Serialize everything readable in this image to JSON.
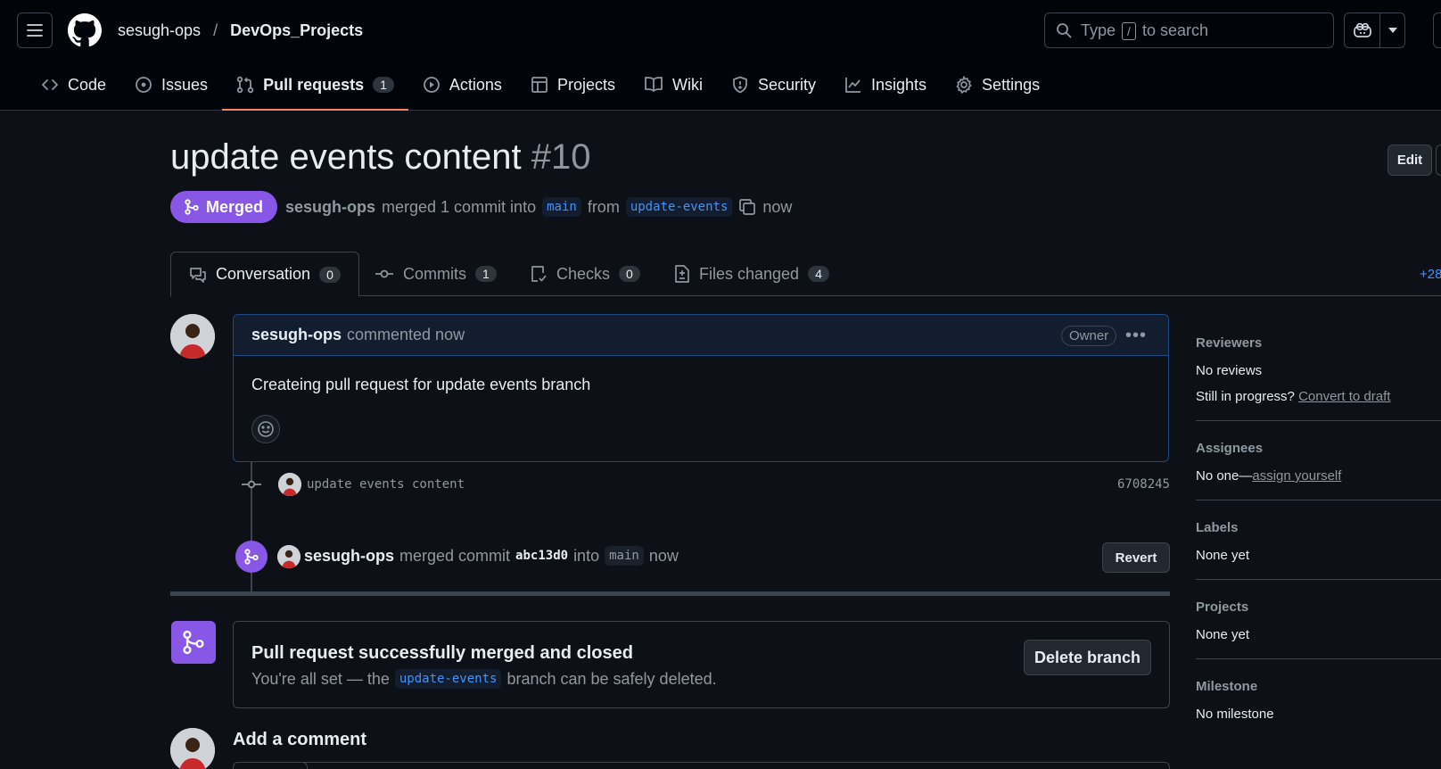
{
  "header": {
    "owner": "sesugh-ops",
    "separator": "/",
    "repo": "DevOps_Projects",
    "search": {
      "before": "Type",
      "key": "/",
      "after": "to search"
    }
  },
  "nav": {
    "items": [
      {
        "label": "Code",
        "icon": "code-icon"
      },
      {
        "label": "Issues",
        "icon": "issue-opened-icon"
      },
      {
        "label": "Pull requests",
        "icon": "git-pull-request-icon",
        "count": "1",
        "active": true
      },
      {
        "label": "Actions",
        "icon": "play-icon"
      },
      {
        "label": "Projects",
        "icon": "table-icon"
      },
      {
        "label": "Wiki",
        "icon": "book-icon"
      },
      {
        "label": "Security",
        "icon": "shield-icon"
      },
      {
        "label": "Insights",
        "icon": "graph-icon"
      },
      {
        "label": "Settings",
        "icon": "gear-icon"
      }
    ]
  },
  "pr": {
    "title": "update events content",
    "number": "#10",
    "edit_label": "Edit",
    "state": "Merged",
    "author": "sesugh-ops",
    "merged_text": "merged 1 commit into",
    "base": "main",
    "from_text": "from",
    "head": "update-events",
    "time": "now"
  },
  "tabs": [
    {
      "label": "Conversation",
      "count": "0",
      "icon": "comment-discussion-icon"
    },
    {
      "label": "Commits",
      "count": "1",
      "icon": "git-commit-icon"
    },
    {
      "label": "Checks",
      "count": "0",
      "icon": "checklist-icon"
    },
    {
      "label": "Files changed",
      "count": "4",
      "icon": "file-diff-icon"
    }
  ],
  "diffstat": "+28",
  "comment": {
    "author": "sesugh-ops",
    "action": "commented now",
    "badge": "Owner",
    "body": "Createing pull request for update events branch"
  },
  "commit": {
    "message": "update events content",
    "sha": "6708245"
  },
  "merge_event": {
    "author": "sesugh-ops",
    "text": "merged commit",
    "sha": "abc13d0",
    "into": "into",
    "base": "main",
    "time": "now",
    "revert_label": "Revert"
  },
  "merged_box": {
    "heading": "Pull request successfully merged and closed",
    "prefix": "You're all set — the",
    "branch": "update-events",
    "suffix": "branch can be safely deleted.",
    "delete_label": "Delete branch"
  },
  "add_comment": "Add a comment",
  "sidebar": {
    "reviewers": {
      "heading": "Reviewers",
      "value": "No reviews",
      "progress_text": "Still in progress?",
      "draft_link": "Convert to draft"
    },
    "assignees": {
      "heading": "Assignees",
      "value": "No one—",
      "link": "assign yourself"
    },
    "labels": {
      "heading": "Labels",
      "value": "None yet"
    },
    "projects": {
      "heading": "Projects",
      "value": "None yet"
    },
    "milestone": {
      "heading": "Milestone",
      "value": "No milestone"
    }
  },
  "colors": {
    "background": "#0d1117",
    "merged_purple": "#8957e5",
    "accent_blue": "#4493f8",
    "nav_underline": "#f78166"
  }
}
